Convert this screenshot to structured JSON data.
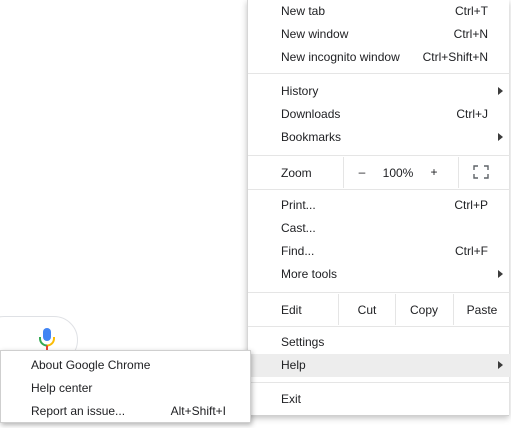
{
  "menu": {
    "group1": [
      {
        "label": "New tab",
        "shortcut": "Ctrl+T"
      },
      {
        "label": "New window",
        "shortcut": "Ctrl+N"
      },
      {
        "label": "New incognito window",
        "shortcut": "Ctrl+Shift+N"
      }
    ],
    "group2": [
      {
        "label": "History",
        "shortcut": "",
        "submenu": true
      },
      {
        "label": "Downloads",
        "shortcut": "Ctrl+J"
      },
      {
        "label": "Bookmarks",
        "shortcut": "",
        "submenu": true
      }
    ],
    "zoom": {
      "label": "Zoom",
      "minus": "–",
      "value": "100%",
      "plus": "+",
      "fullscreen_icon": "fullscreen-icon"
    },
    "group3": [
      {
        "label": "Print...",
        "shortcut": "Ctrl+P"
      },
      {
        "label": "Cast...",
        "shortcut": ""
      },
      {
        "label": "Find...",
        "shortcut": "Ctrl+F"
      },
      {
        "label": "More tools",
        "shortcut": "",
        "submenu": true
      }
    ],
    "edit": {
      "label": "Edit",
      "cut": "Cut",
      "copy": "Copy",
      "paste": "Paste"
    },
    "group4": [
      {
        "label": "Settings",
        "shortcut": ""
      },
      {
        "label": "Help",
        "shortcut": "",
        "submenu": true,
        "highlighted": true
      }
    ],
    "exit": {
      "label": "Exit"
    }
  },
  "help_submenu": [
    {
      "label": "About Google Chrome",
      "shortcut": ""
    },
    {
      "label": "Help center",
      "shortcut": ""
    },
    {
      "label": "Report an issue...",
      "shortcut": "Alt+Shift+I"
    }
  ],
  "background": {
    "mic_icon": "microphone-icon"
  },
  "colors": {
    "highlight": "#ededed",
    "separator": "#e5e5e5",
    "text": "#202124",
    "mic_blue": "#4285F4",
    "mic_red": "#EA4335",
    "mic_yellow": "#FBBC05",
    "mic_green": "#34A853"
  }
}
